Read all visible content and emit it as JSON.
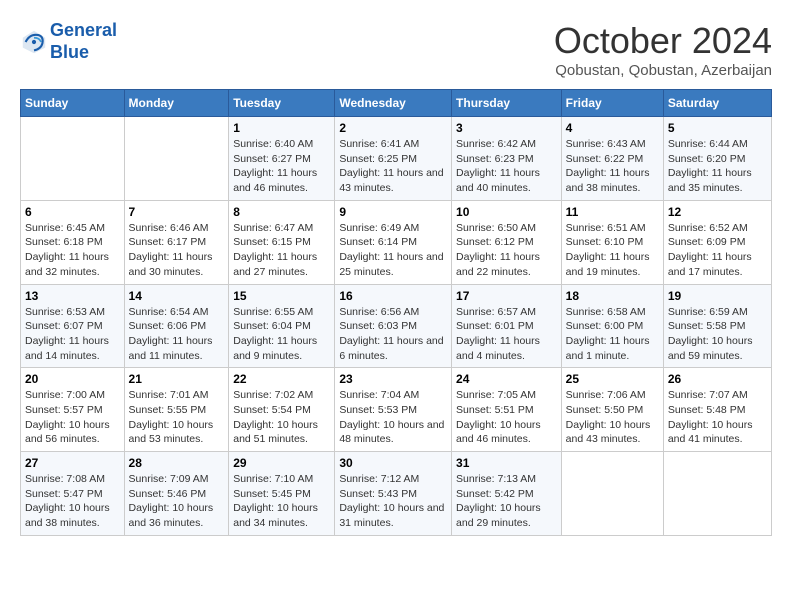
{
  "header": {
    "logo_line1": "General",
    "logo_line2": "Blue",
    "month": "October 2024",
    "location": "Qobustan, Qobustan, Azerbaijan"
  },
  "weekdays": [
    "Sunday",
    "Monday",
    "Tuesday",
    "Wednesday",
    "Thursday",
    "Friday",
    "Saturday"
  ],
  "weeks": [
    [
      {
        "day": "",
        "info": ""
      },
      {
        "day": "",
        "info": ""
      },
      {
        "day": "1",
        "info": "Sunrise: 6:40 AM\nSunset: 6:27 PM\nDaylight: 11 hours and 46 minutes."
      },
      {
        "day": "2",
        "info": "Sunrise: 6:41 AM\nSunset: 6:25 PM\nDaylight: 11 hours and 43 minutes."
      },
      {
        "day": "3",
        "info": "Sunrise: 6:42 AM\nSunset: 6:23 PM\nDaylight: 11 hours and 40 minutes."
      },
      {
        "day": "4",
        "info": "Sunrise: 6:43 AM\nSunset: 6:22 PM\nDaylight: 11 hours and 38 minutes."
      },
      {
        "day": "5",
        "info": "Sunrise: 6:44 AM\nSunset: 6:20 PM\nDaylight: 11 hours and 35 minutes."
      }
    ],
    [
      {
        "day": "6",
        "info": "Sunrise: 6:45 AM\nSunset: 6:18 PM\nDaylight: 11 hours and 32 minutes."
      },
      {
        "day": "7",
        "info": "Sunrise: 6:46 AM\nSunset: 6:17 PM\nDaylight: 11 hours and 30 minutes."
      },
      {
        "day": "8",
        "info": "Sunrise: 6:47 AM\nSunset: 6:15 PM\nDaylight: 11 hours and 27 minutes."
      },
      {
        "day": "9",
        "info": "Sunrise: 6:49 AM\nSunset: 6:14 PM\nDaylight: 11 hours and 25 minutes."
      },
      {
        "day": "10",
        "info": "Sunrise: 6:50 AM\nSunset: 6:12 PM\nDaylight: 11 hours and 22 minutes."
      },
      {
        "day": "11",
        "info": "Sunrise: 6:51 AM\nSunset: 6:10 PM\nDaylight: 11 hours and 19 minutes."
      },
      {
        "day": "12",
        "info": "Sunrise: 6:52 AM\nSunset: 6:09 PM\nDaylight: 11 hours and 17 minutes."
      }
    ],
    [
      {
        "day": "13",
        "info": "Sunrise: 6:53 AM\nSunset: 6:07 PM\nDaylight: 11 hours and 14 minutes."
      },
      {
        "day": "14",
        "info": "Sunrise: 6:54 AM\nSunset: 6:06 PM\nDaylight: 11 hours and 11 minutes."
      },
      {
        "day": "15",
        "info": "Sunrise: 6:55 AM\nSunset: 6:04 PM\nDaylight: 11 hours and 9 minutes."
      },
      {
        "day": "16",
        "info": "Sunrise: 6:56 AM\nSunset: 6:03 PM\nDaylight: 11 hours and 6 minutes."
      },
      {
        "day": "17",
        "info": "Sunrise: 6:57 AM\nSunset: 6:01 PM\nDaylight: 11 hours and 4 minutes."
      },
      {
        "day": "18",
        "info": "Sunrise: 6:58 AM\nSunset: 6:00 PM\nDaylight: 11 hours and 1 minute."
      },
      {
        "day": "19",
        "info": "Sunrise: 6:59 AM\nSunset: 5:58 PM\nDaylight: 10 hours and 59 minutes."
      }
    ],
    [
      {
        "day": "20",
        "info": "Sunrise: 7:00 AM\nSunset: 5:57 PM\nDaylight: 10 hours and 56 minutes."
      },
      {
        "day": "21",
        "info": "Sunrise: 7:01 AM\nSunset: 5:55 PM\nDaylight: 10 hours and 53 minutes."
      },
      {
        "day": "22",
        "info": "Sunrise: 7:02 AM\nSunset: 5:54 PM\nDaylight: 10 hours and 51 minutes."
      },
      {
        "day": "23",
        "info": "Sunrise: 7:04 AM\nSunset: 5:53 PM\nDaylight: 10 hours and 48 minutes."
      },
      {
        "day": "24",
        "info": "Sunrise: 7:05 AM\nSunset: 5:51 PM\nDaylight: 10 hours and 46 minutes."
      },
      {
        "day": "25",
        "info": "Sunrise: 7:06 AM\nSunset: 5:50 PM\nDaylight: 10 hours and 43 minutes."
      },
      {
        "day": "26",
        "info": "Sunrise: 7:07 AM\nSunset: 5:48 PM\nDaylight: 10 hours and 41 minutes."
      }
    ],
    [
      {
        "day": "27",
        "info": "Sunrise: 7:08 AM\nSunset: 5:47 PM\nDaylight: 10 hours and 38 minutes."
      },
      {
        "day": "28",
        "info": "Sunrise: 7:09 AM\nSunset: 5:46 PM\nDaylight: 10 hours and 36 minutes."
      },
      {
        "day": "29",
        "info": "Sunrise: 7:10 AM\nSunset: 5:45 PM\nDaylight: 10 hours and 34 minutes."
      },
      {
        "day": "30",
        "info": "Sunrise: 7:12 AM\nSunset: 5:43 PM\nDaylight: 10 hours and 31 minutes."
      },
      {
        "day": "31",
        "info": "Sunrise: 7:13 AM\nSunset: 5:42 PM\nDaylight: 10 hours and 29 minutes."
      },
      {
        "day": "",
        "info": ""
      },
      {
        "day": "",
        "info": ""
      }
    ]
  ]
}
